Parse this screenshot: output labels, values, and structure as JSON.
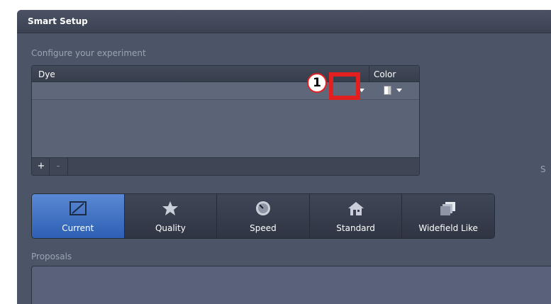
{
  "window": {
    "title": "Smart Setup"
  },
  "configure": {
    "label": "Configure your experiment",
    "table": {
      "columns": [
        "Dye",
        "Color"
      ],
      "add_label": "+",
      "remove_label": "-"
    }
  },
  "annotation": {
    "marker": "1",
    "color": "#e32020"
  },
  "modes": [
    {
      "label": "Current",
      "icon": "current-frame-icon",
      "active": true
    },
    {
      "label": "Quality",
      "icon": "star-icon",
      "active": false
    },
    {
      "label": "Speed",
      "icon": "speedometer-icon",
      "active": false
    },
    {
      "label": "Standard",
      "icon": "home-icon",
      "active": false
    },
    {
      "label": "Widefield Like",
      "icon": "stacked-layers-icon",
      "active": false
    }
  ],
  "proposals": {
    "label": "Proposals"
  },
  "cutoff_text": "S",
  "colors": {
    "accent": "#3a6cc0",
    "panel": "#4b5567"
  }
}
